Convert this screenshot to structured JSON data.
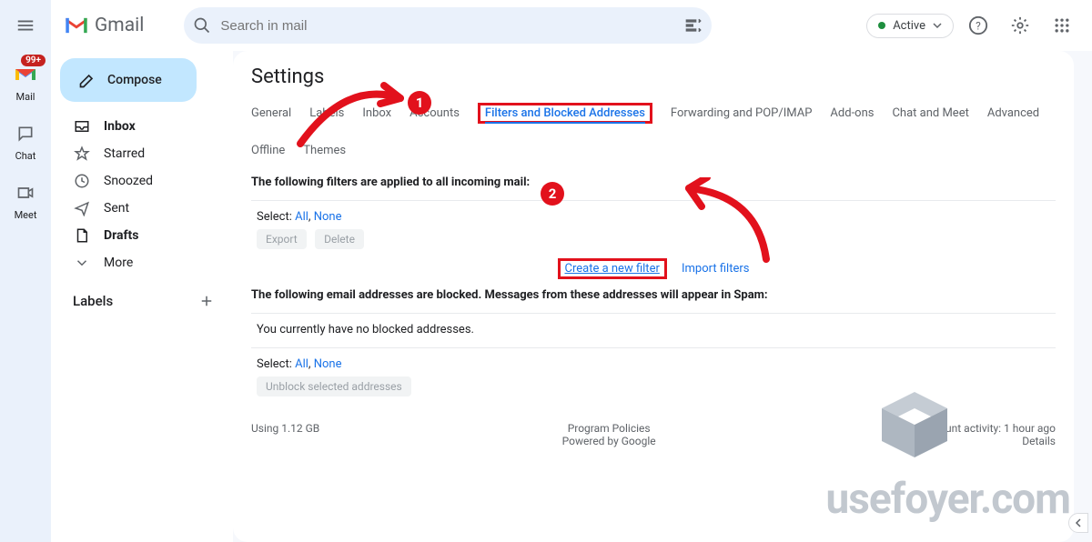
{
  "leftbar": {
    "badge": "99+",
    "items": [
      "Mail",
      "Chat",
      "Meet"
    ]
  },
  "header": {
    "brand": "Gmail",
    "search_placeholder": "Search in mail",
    "status": "Active"
  },
  "sidebar": {
    "compose": "Compose",
    "nav": [
      {
        "label": "Inbox",
        "bold": true
      },
      {
        "label": "Starred",
        "bold": false
      },
      {
        "label": "Snoozed",
        "bold": false
      },
      {
        "label": "Sent",
        "bold": false
      },
      {
        "label": "Drafts",
        "bold": true
      },
      {
        "label": "More",
        "bold": false
      }
    ],
    "labels_title": "Labels"
  },
  "main": {
    "title": "Settings",
    "tabs": [
      "General",
      "Labels",
      "Inbox",
      "Accounts",
      "Filters and Blocked Addresses",
      "Forwarding and POP/IMAP",
      "Add-ons",
      "Chat and Meet",
      "Advanced",
      "Offline",
      "Themes"
    ],
    "active_tab_index": 4,
    "filters_head": "The following filters are applied to all incoming mail:",
    "select_label": "Select:",
    "all": "All",
    "none": "None",
    "export": "Export",
    "delete": "Delete",
    "create_filter": "Create a new filter",
    "import_filters": "Import filters",
    "blocked_head": "The following email addresses are blocked. Messages from these addresses will appear in Spam:",
    "no_blocked": "You currently have no blocked addresses.",
    "unblock": "Unblock selected addresses"
  },
  "footer": {
    "usage": "Using 1.12 GB",
    "policies": "Program Policies",
    "powered": "Powered by Google",
    "activity": "Last account activity: 1 hour ago",
    "details": "Details"
  },
  "annot": {
    "one": "1",
    "two": "2"
  },
  "watermark": "usefoyer.com"
}
